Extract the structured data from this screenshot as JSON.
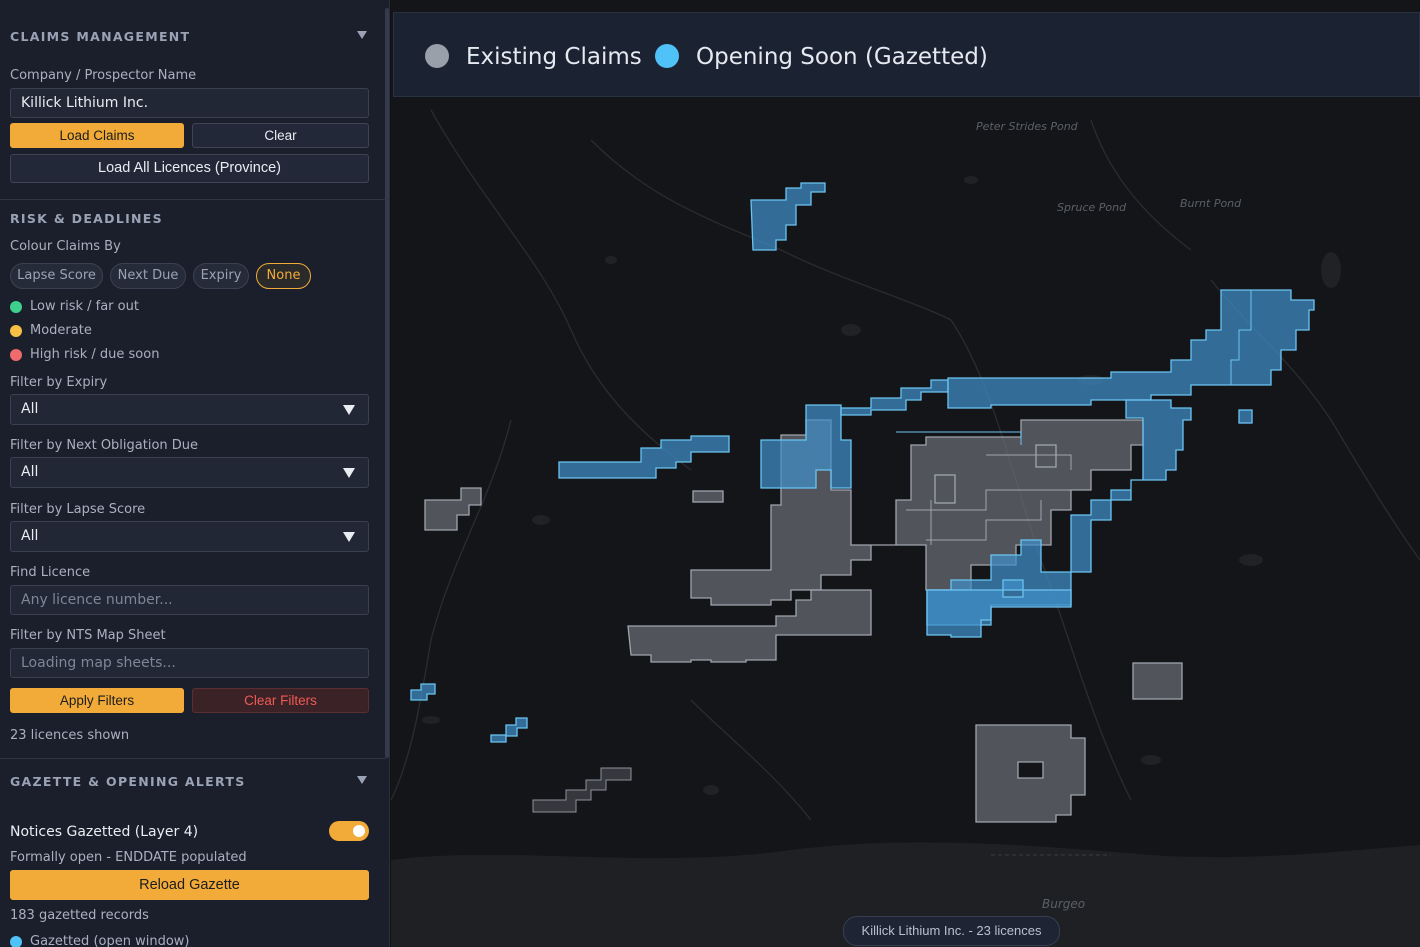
{
  "sidebar": {
    "claims_section": {
      "title": "CLAIMS MANAGEMENT",
      "company_label": "Company / Prospector Name",
      "company_value": "Killick Lithium Inc.",
      "load_claims": "Load Claims",
      "clear": "Clear",
      "load_all": "Load All Licences (Province)"
    },
    "risk_section": {
      "title": "RISK & DEADLINES",
      "colour_by_label": "Colour Claims By",
      "colour_options": [
        "Lapse Score",
        "Next Due",
        "Expiry",
        "None"
      ],
      "selected_option": "None",
      "legend": [
        {
          "label": "Low risk / far out",
          "color": "#3ecf8e"
        },
        {
          "label": "Moderate",
          "color": "#f5c043"
        },
        {
          "label": "High risk / due soon",
          "color": "#f06b6b"
        }
      ],
      "filter_expiry_label": "Filter by Expiry",
      "filter_expiry_value": "All",
      "filter_next_label": "Filter by Next Obligation Due",
      "filter_next_value": "All",
      "filter_lapse_label": "Filter by Lapse Score",
      "filter_lapse_value": "All",
      "find_licence_label": "Find Licence",
      "find_licence_placeholder": "Any licence number...",
      "nts_label": "Filter by NTS Map Sheet",
      "nts_placeholder": "Loading map sheets...",
      "apply_filters": "Apply Filters",
      "clear_filters": "Clear Filters",
      "count_text": "23 licences shown"
    },
    "gazette_section": {
      "title": "GAZETTE & OPENING ALERTS",
      "toggle_label": "Notices Gazetted (Layer 4)",
      "toggle_on": true,
      "subtitle": "Formally open - ENDDATE populated",
      "reload": "Reload Gazette",
      "records": "183 gazetted records",
      "legend_item": "Gazetted (open window)",
      "legend_color": "#4fc3f7"
    }
  },
  "map": {
    "legend": [
      {
        "label": "Existing Claims",
        "color": "#9aa0aa"
      },
      {
        "label": "Opening Soon (Gazetted)",
        "color": "#4fc3f7"
      }
    ],
    "places": [
      "Peter Strides Pond",
      "Spruce Pond",
      "Burnt Pond",
      "Burgeo"
    ],
    "footer": "Killick Lithium Inc. - 23 licences",
    "colors": {
      "existing_fill": "#6b6e76",
      "gazetted_fill": "#3e8fc7"
    }
  }
}
